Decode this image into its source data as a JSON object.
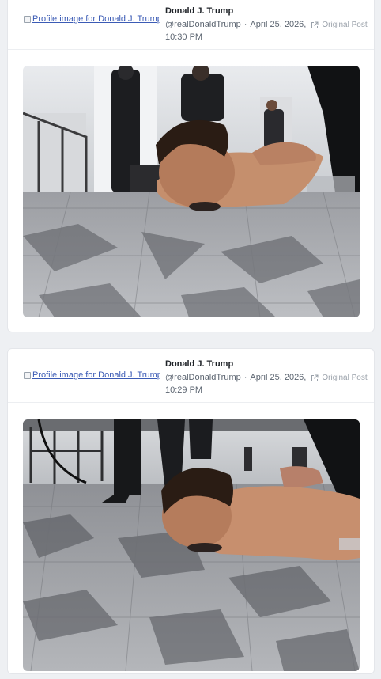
{
  "posts": [
    {
      "profile_image_alt": "Profile image for Donald J. Trump",
      "author_name": "Donald J. Trump",
      "handle": "@realDonaldTrump",
      "date": "April 25, 2026,",
      "original_post_label": "Original Post",
      "time": "10:30 PM",
      "image_description": "Photo of a shirtless man lying face down on a patterned carpet with hands behind his back while uniformed officers stand in a hotel lobby"
    },
    {
      "profile_image_alt": "Profile image for Donald J. Trump",
      "author_name": "Donald J. Trump",
      "handle": "@realDonaldTrump",
      "date": "April 25, 2026,",
      "original_post_label": "Original Post",
      "time": "10:29 PM",
      "image_description": "Close-up photo of a shirtless man lying face down on a carpet with his hands restrained behind his back"
    }
  ],
  "colors": {
    "link": "#3b5bb5",
    "muted_text": "#5b6470",
    "card_border": "#e4e6ea"
  },
  "icons": [
    "broken-image-icon",
    "external-link-icon"
  ]
}
